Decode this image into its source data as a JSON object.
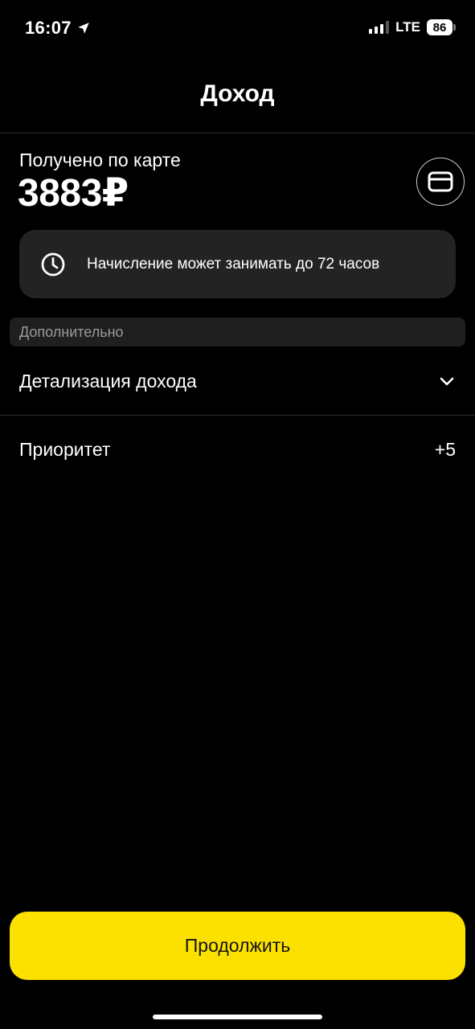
{
  "status_bar": {
    "time": "16:07",
    "network": "LTE",
    "battery": "86"
  },
  "header": {
    "title": "Доход"
  },
  "income": {
    "label": "Получено по карте",
    "amount": "3883₽"
  },
  "notice": {
    "icon": "clock-icon",
    "text": "Начисление может занимать до 72 часов"
  },
  "section": {
    "title": "Дополнительно"
  },
  "rows": {
    "details": {
      "label": "Детализация дохода",
      "icon": "chevron-down-icon"
    },
    "priority": {
      "label": "Приоритет",
      "value": "+5"
    }
  },
  "footer": {
    "continue_label": "Продолжить"
  },
  "colors": {
    "accent": "#fce000",
    "background": "#000000",
    "card": "#232323"
  }
}
